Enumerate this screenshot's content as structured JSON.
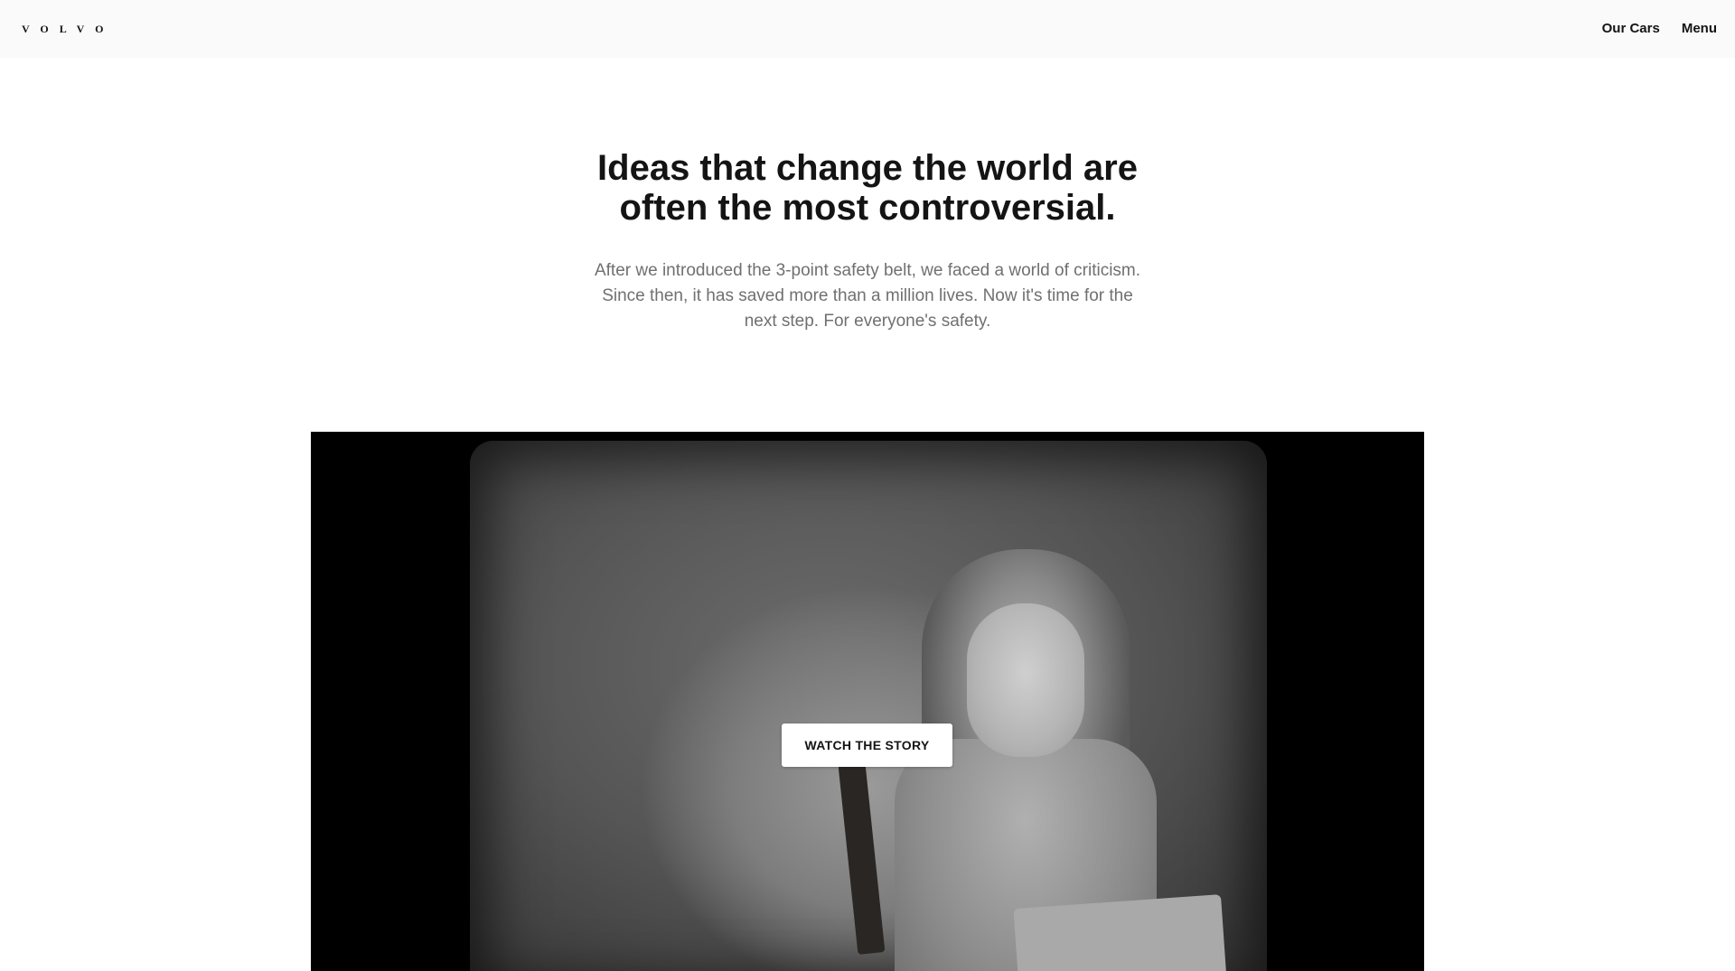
{
  "header": {
    "logo_text": "VOLVO",
    "nav": {
      "our_cars": "Our Cars",
      "menu": "Menu"
    }
  },
  "hero": {
    "headline": "Ideas that change the world are often the most controversial.",
    "intro": "After we introduced the 3-point safety belt, we faced a world of criticism. Since then, it has saved more than a million lives. Now it's time for the next step. For everyone's safety.",
    "video": {
      "cta_label": "WATCH THE STORY"
    }
  },
  "colors": {
    "topbar_bg": "#fafafa",
    "text_primary": "#141414",
    "text_secondary": "#707070",
    "video_bg": "#000000",
    "cta_bg": "#ffffff"
  }
}
